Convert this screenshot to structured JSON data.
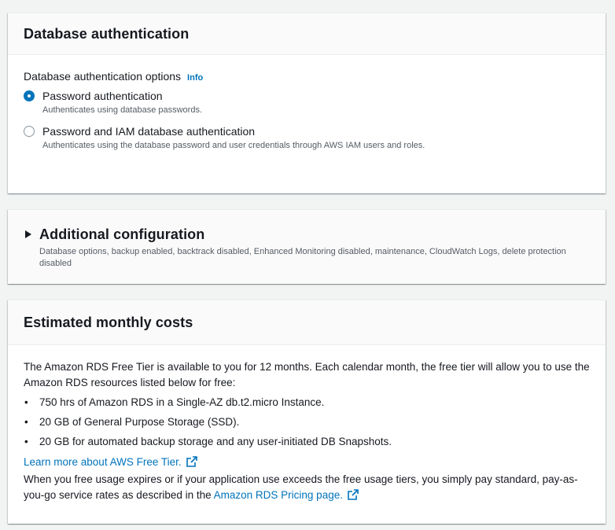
{
  "db_auth": {
    "title": "Database authentication",
    "options_label": "Database authentication options",
    "info": "Info",
    "options": [
      {
        "title": "Password authentication",
        "description": "Authenticates using database passwords.",
        "selected": true
      },
      {
        "title": "Password and IAM database authentication",
        "description": "Authenticates using the database password and user credentials through AWS IAM users and roles.",
        "selected": false
      }
    ]
  },
  "additional": {
    "title": "Additional configuration",
    "description": "Database options, backup enabled, backtrack disabled, Enhanced Monitoring disabled, maintenance, CloudWatch Logs, delete protection disabled"
  },
  "costs": {
    "title": "Estimated monthly costs",
    "intro": "The Amazon RDS Free Tier is available to you for 12 months. Each calendar month, the free tier will allow you to use the Amazon RDS resources listed below for free:",
    "items": [
      "750 hrs of Amazon RDS in a Single-AZ db.t2.micro Instance.",
      "20 GB of General Purpose Storage (SSD).",
      "20 GB for automated backup storage and any user-initiated DB Snapshots."
    ],
    "learn_more": "Learn more about AWS Free Tier.",
    "outro": "When you free usage expires or if your application use exceeds the free usage tiers, you simply pay standard, pay-as-you-go service rates as described in the",
    "pricing_link": "Amazon RDS Pricing page."
  },
  "colors": {
    "accent": "#0073bb",
    "text": "#16191f",
    "muted": "#545b64",
    "background": "#f2f3f3"
  },
  "icons": [
    "external-link-icon",
    "caret-right-icon"
  ]
}
